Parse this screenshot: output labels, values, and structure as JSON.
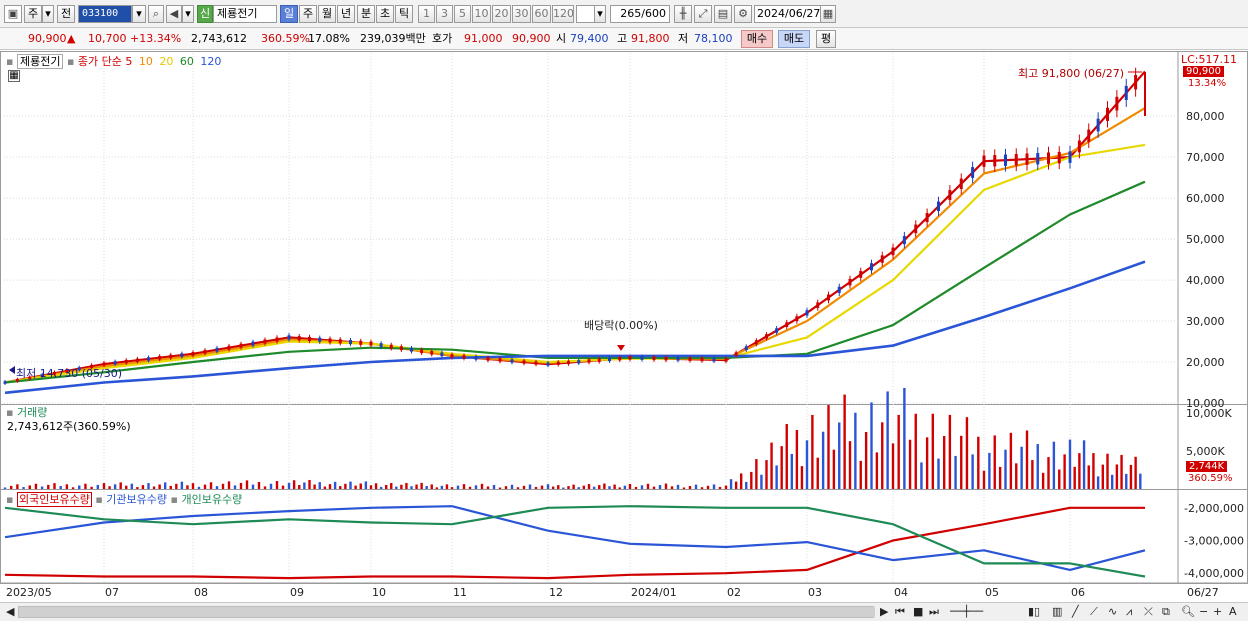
{
  "toolbar": {
    "market_tab": "주",
    "prev_label": "전",
    "stock_code": "033100",
    "sin_badge": "신",
    "stock_name": "제룡전기",
    "period_buttons": [
      "일",
      "주",
      "월",
      "년",
      "분",
      "초",
      "틱"
    ],
    "active_period": "일",
    "interval_buttons": [
      "1",
      "3",
      "5",
      "10",
      "20",
      "30",
      "60",
      "120"
    ],
    "bar_count": "265",
    "bar_total": "/600",
    "date": "2024/06/27"
  },
  "quote": {
    "price": "90,900",
    "arrow": "▲",
    "change": "10,700",
    "change_pct": "+13.34%",
    "volume": "2,743,612",
    "volume_pct": "360.59%",
    "turnover": "17.08%",
    "amount": "239,039백만",
    "ask_label": "호가",
    "ask": "91,000",
    "bid": "90,900",
    "open_label": "시",
    "open": "79,400",
    "high_label": "고",
    "high": "91,800",
    "low_label": "저",
    "low": "78,100",
    "buy_label": "매수",
    "sell_label": "매도",
    "eval_label": "평"
  },
  "price_panel": {
    "legend_name": "제룡전기",
    "legend_ma_label": "종가 단순",
    "ma_periods": [
      "5",
      "10",
      "20",
      "60",
      "120"
    ],
    "ma_colors": [
      "#d10000",
      "#f08a00",
      "#e8d800",
      "#1e8a2a",
      "#2a55d6"
    ],
    "lc_label": "LC:517.11",
    "price_tag": "90,900",
    "pct_tag": "13.34%",
    "high_annotation": "최고 91,800 (06/27)",
    "low_annotation": "최저 14,730 (05/30)",
    "dividend_annotation": "배당락(0.00%)",
    "y_ticks": [
      "80,000",
      "70,000",
      "60,000",
      "50,000",
      "40,000",
      "30,000",
      "20,000",
      "10,000"
    ]
  },
  "volume_panel": {
    "title": "거래량",
    "value": "2,743,612주(360.59%)",
    "y_ticks": [
      "10,000K",
      "5,000K"
    ],
    "tag": "2,744K",
    "tag_pct": "360.59%"
  },
  "holdings_panel": {
    "series": [
      "외국인보유수량",
      "기관보유수량",
      "개인보유수량"
    ],
    "series_colors": [
      "#d10000",
      "#2a55d6",
      "#1e8a56"
    ],
    "y_ticks": [
      "-2,000,000",
      "-3,000,000",
      "-4,000,000"
    ]
  },
  "x_axis": [
    "2023/05",
    "07",
    "08",
    "09",
    "10",
    "11",
    "12",
    "2024/01",
    "02",
    "03",
    "04",
    "05",
    "06",
    "06/27"
  ],
  "chart_data": [
    {
      "type": "line",
      "title": "제룡전기",
      "x": [
        "2023/05",
        "2023/07",
        "2023/08",
        "2023/09",
        "2023/10",
        "2023/11",
        "2023/12",
        "2024/01",
        "2024/02",
        "2024/03",
        "2024/04",
        "2024/05",
        "2024/06",
        "2024/06/27"
      ],
      "ylim": [
        10000,
        92000
      ],
      "series": [
        {
          "name": "5",
          "values": [
            15000,
            19500,
            22000,
            26000,
            24500,
            21500,
            19500,
            21000,
            20500,
            32000,
            47000,
            69000,
            70000,
            90900
          ]
        },
        {
          "name": "10",
          "values": [
            15000,
            19000,
            21500,
            25500,
            24500,
            21500,
            19800,
            21000,
            20800,
            30000,
            45000,
            66000,
            71000,
            82000
          ]
        },
        {
          "name": "20",
          "values": [
            15000,
            18500,
            21000,
            25000,
            24500,
            22000,
            20000,
            20800,
            20900,
            26000,
            40000,
            62000,
            70000,
            73000
          ]
        },
        {
          "name": "60",
          "values": [
            15000,
            17500,
            20000,
            22500,
            23500,
            23000,
            21000,
            21000,
            21000,
            22000,
            29000,
            43000,
            56000,
            64000
          ]
        },
        {
          "name": "120",
          "values": [
            12500,
            15000,
            16500,
            18500,
            20000,
            21000,
            21500,
            21500,
            21500,
            21500,
            24000,
            31000,
            38000,
            44500
          ]
        }
      ]
    },
    {
      "type": "bar",
      "title": "거래량",
      "x": [
        "2023/05",
        "2023/07",
        "2023/08",
        "2023/09",
        "2023/10",
        "2023/11",
        "2023/12",
        "2024/01",
        "2024/02",
        "2024/03",
        "2024/04",
        "2024/05",
        "2024/06",
        "2024/06/27"
      ],
      "values": [
        500,
        600,
        700,
        900,
        700,
        500,
        450,
        550,
        450,
        8000,
        10000,
        6000,
        5000,
        2744
      ],
      "unit": "K",
      "ylim": [
        0,
        10000
      ]
    },
    {
      "type": "line",
      "title": "보유수량",
      "x": [
        "2023/05",
        "2023/07",
        "2023/08",
        "2023/09",
        "2023/10",
        "2023/11",
        "2023/12",
        "2024/01",
        "2024/02",
        "2024/03",
        "2024/04",
        "2024/05",
        "2024/06",
        "2024/06/27"
      ],
      "ylim": [
        -4300000,
        -1700000
      ],
      "series": [
        {
          "name": "외국인보유수량",
          "values": [
            -4050000,
            -4100000,
            -4100000,
            -4150000,
            -4100000,
            -4100000,
            -4150000,
            -4050000,
            -4000000,
            -3900000,
            -3000000,
            -2500000,
            -2000000,
            -2000000
          ]
        },
        {
          "name": "기관보유수량",
          "values": [
            -2900000,
            -2450000,
            -2250000,
            -2100000,
            -2000000,
            -1950000,
            -2700000,
            -3100000,
            -3200000,
            -3050000,
            -3600000,
            -3300000,
            -3900000,
            -3300000
          ]
        },
        {
          "name": "개인보유수량",
          "values": [
            -2000000,
            -2350000,
            -2500000,
            -2350000,
            -2450000,
            -2500000,
            -2000000,
            -1950000,
            -2000000,
            -2000000,
            -2500000,
            -3700000,
            -3700000,
            -4100000
          ]
        }
      ]
    }
  ]
}
